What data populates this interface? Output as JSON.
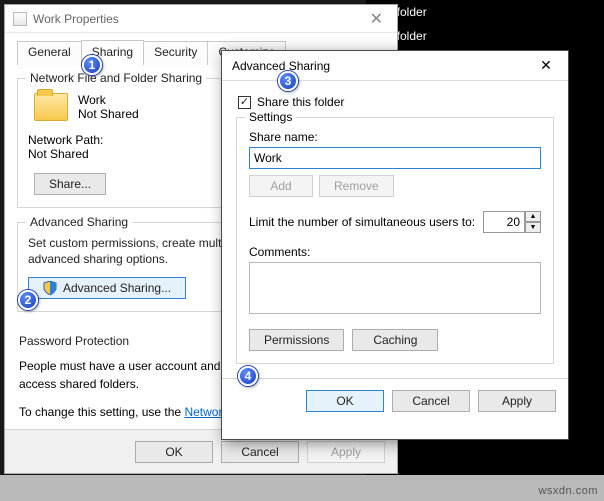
{
  "background": {
    "rows": [
      "File folder",
      "File folder"
    ]
  },
  "watermark": "wsxdn.com",
  "properties": {
    "title": "Work Properties",
    "tabs": [
      "General",
      "Sharing",
      "Security",
      "Customize"
    ],
    "active_tab": "Sharing",
    "network_group": {
      "title": "Network File and Folder Sharing",
      "folder_name": "Work",
      "folder_status": "Not Shared",
      "network_path_label": "Network Path:",
      "network_path_value": "Not Shared",
      "share_button": "Share..."
    },
    "advanced_group": {
      "title": "Advanced Sharing",
      "desc": "Set custom permissions, create multiple shares, and set other advanced sharing options.",
      "button": "Advanced Sharing..."
    },
    "password_group": {
      "title": "Password Protection",
      "line1": "People must have a user account and password for this computer to access shared folders.",
      "line2_a": "To change this setting, use the ",
      "link": "Network and Sharing Center"
    },
    "buttons": {
      "ok": "OK",
      "cancel": "Cancel",
      "apply": "Apply"
    }
  },
  "advanced": {
    "title": "Advanced Sharing",
    "share_this": "Share this folder",
    "settings_label": "Settings",
    "share_name_label": "Share name:",
    "share_name_value": "Work",
    "add": "Add",
    "remove": "Remove",
    "limit_label": "Limit the number of simultaneous users to:",
    "limit_value": "20",
    "comments_label": "Comments:",
    "comments_value": "",
    "permissions": "Permissions",
    "caching": "Caching",
    "ok": "OK",
    "cancel": "Cancel",
    "apply": "Apply"
  },
  "callouts": {
    "c1": "1",
    "c2": "2",
    "c3": "3",
    "c4": "4"
  }
}
